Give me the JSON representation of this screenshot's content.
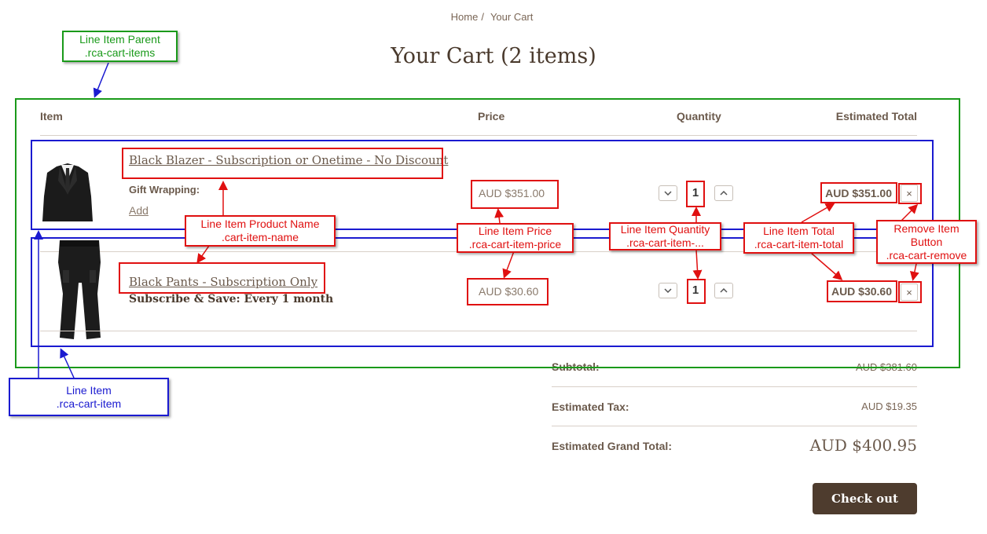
{
  "breadcrumb": {
    "home": "Home",
    "separator": "/",
    "current": "Your Cart"
  },
  "page": {
    "title": "Your Cart (2 items)"
  },
  "table": {
    "headers": {
      "item": "Item",
      "price": "Price",
      "quantity": "Quantity",
      "total": "Estimated Total"
    }
  },
  "items": [
    {
      "name": "Black Blazer - Subscription or Onetime - No Discount",
      "gift_label": "Gift Wrapping:",
      "add_label": "Add",
      "price": "AUD $351.00",
      "quantity": "1",
      "total": "AUD $351.00",
      "remove": "×",
      "image_icon": "blazer-image"
    },
    {
      "name": "Black Pants - Subscription Only",
      "subscription_note": "Subscribe & Save: Every 1 month",
      "price": "AUD $30.60",
      "quantity": "1",
      "total": "AUD $30.60",
      "remove": "×",
      "image_icon": "pants-image"
    }
  ],
  "summary": {
    "subtotal_label": "Subtotal:",
    "subtotal_value": "AUD $381.60",
    "tax_label": "Estimated Tax:",
    "tax_value": "AUD $19.35",
    "grand_label": "Estimated Grand Total:",
    "grand_value": "AUD $400.95"
  },
  "checkout_label": "Check out",
  "annotations": {
    "parent": {
      "line1": "Line Item Parent",
      "line2": ".rca-cart-items"
    },
    "line_item": {
      "line1": "Line Item",
      "line2": ".rca-cart-item"
    },
    "product_name": {
      "line1": "Line Item Product Name",
      "line2": ".cart-item-name"
    },
    "price": {
      "line1": "Line Item Price",
      "line2": ".rca-cart-item-price"
    },
    "quantity": {
      "line1": "Line Item Quantity",
      "line2": ".rca-cart-item-..."
    },
    "total": {
      "line1": "Line Item Total",
      "line2": ".rca-cart-item-total"
    },
    "remove": {
      "line1": "Remove Item",
      "line2": "Button",
      "line3": ".rca-cart-remove"
    }
  },
  "colors": {
    "annotation_green": "#1a9a1a",
    "annotation_blue": "#1a1ad0",
    "annotation_red": "#e01010",
    "checkout_bg": "#4e3c2e"
  }
}
